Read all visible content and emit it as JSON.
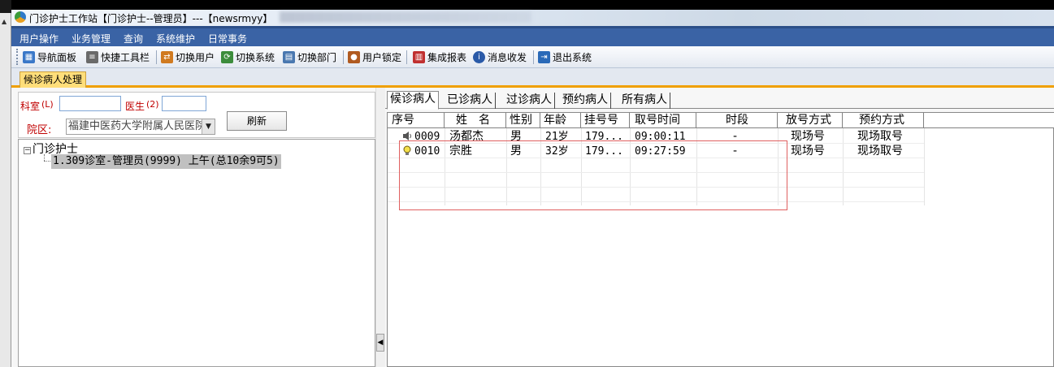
{
  "window": {
    "title": "门诊护士工作站【门诊护士--管理员】---【newsrmyy】"
  },
  "menu": [
    "用户操作",
    "业务管理",
    "查询",
    "系统维护",
    "日常事务"
  ],
  "toolbar": [
    {
      "label": "导航面板",
      "icon": "navigation-panel-icon",
      "color": "#3a78c8"
    },
    {
      "label": "快捷工具栏",
      "icon": "quick-toolbar-icon",
      "color": "#6a6a6a"
    },
    {
      "label": "切换用户",
      "icon": "switch-user-icon",
      "color": "#d07a20"
    },
    {
      "label": "切换系统",
      "icon": "switch-system-icon",
      "color": "#3c8c3c"
    },
    {
      "label": "切换部门",
      "icon": "switch-department-icon",
      "color": "#4a78b0"
    },
    {
      "label": "用户锁定",
      "icon": "user-lock-icon",
      "color": "#b05a20"
    },
    {
      "label": "集成报表",
      "icon": "integrated-report-icon",
      "color": "#c03030"
    },
    {
      "label": "消息收发",
      "icon": "message-icon",
      "color": "#2a5aa8"
    },
    {
      "label": "退出系统",
      "icon": "exit-icon",
      "color": "#2a6ab8"
    }
  ],
  "main_tab": "候诊病人处理",
  "filters": {
    "dept_label": "科室",
    "dept_hotkey": "(L)",
    "dept_value": "",
    "doctor_label": "医生",
    "doctor_hotkey": "(2)",
    "doctor_value": "",
    "hospital_label": "院区:",
    "hospital_value": "福建中医药大学附属人民医院",
    "refresh_label": "刷新"
  },
  "tree": {
    "root": "门诊护士",
    "child": "1.309诊室-管理员(9999) 上午(总10余9可5)"
  },
  "patient_tabs": [
    "候诊病人",
    "已诊病人",
    "过诊病人",
    "预约病人",
    "所有病人"
  ],
  "active_patient_tab": "候诊病人",
  "columns": [
    "序号",
    "姓　名",
    "性别",
    "年龄",
    "挂号号",
    "取号时间",
    "时段",
    "放号方式",
    "预约方式"
  ],
  "rows": [
    {
      "icon": "speaker-icon",
      "no": "0009",
      "name": "汤都杰",
      "sex": "男",
      "age": "21岁",
      "reg": "179...",
      "time": "09:00:11",
      "period": "-",
      "release": "现场号",
      "booking": "现场取号"
    },
    {
      "icon": "lightbulb-icon",
      "no": "0010",
      "name": "宗胜",
      "sex": "男",
      "age": "32岁",
      "reg": "179...",
      "time": "09:27:59",
      "period": "-",
      "release": "现场号",
      "booking": "现场取号"
    }
  ]
}
